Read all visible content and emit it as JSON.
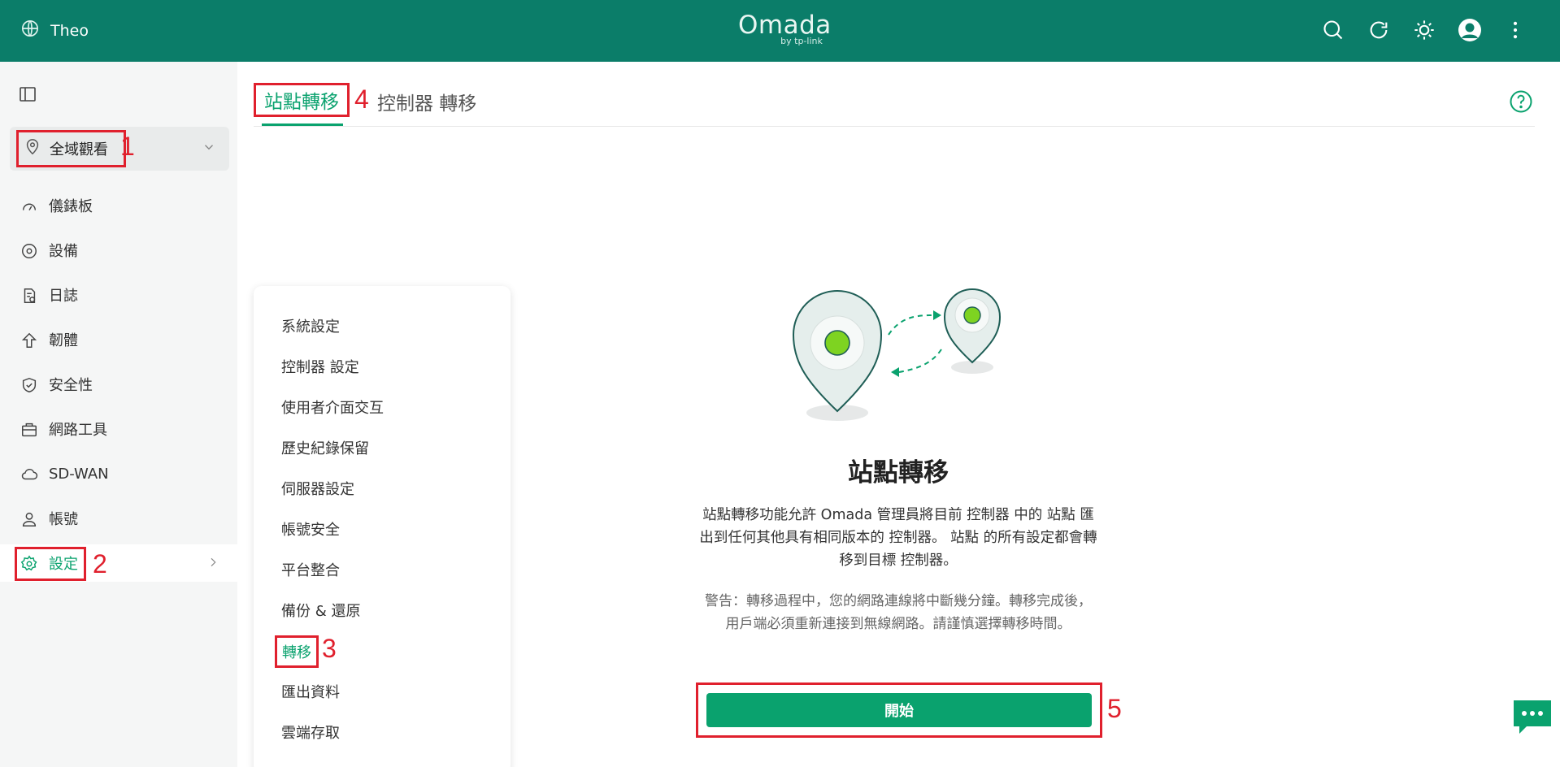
{
  "topbar": {
    "site_name": "Theo",
    "logo_text": "Omada",
    "logo_sub": "by tp-link",
    "actions": [
      "search-icon",
      "refresh-icon",
      "theme-icon",
      "avatar",
      "more-icon"
    ],
    "color": "#0b7d69"
  },
  "sidebar": {
    "scope_label": "全域觀看",
    "items": [
      {
        "label": "儀錶板",
        "icon": "dashboard-icon"
      },
      {
        "label": "設備",
        "icon": "devices-icon"
      },
      {
        "label": "日誌",
        "icon": "logs-icon"
      },
      {
        "label": "韌體",
        "icon": "firmware-icon"
      },
      {
        "label": "安全性",
        "icon": "shield-icon"
      },
      {
        "label": "網路工具",
        "icon": "toolbox-icon"
      },
      {
        "label": "SD-WAN",
        "icon": "cloud-icon"
      },
      {
        "label": "帳號",
        "icon": "user-icon"
      },
      {
        "label": "設定",
        "icon": "gear-icon",
        "active": true
      }
    ]
  },
  "submenu": {
    "items": [
      "系統設定",
      "控制器 設定",
      "使用者介面交互",
      "歷史紀錄保留",
      "伺服器設定",
      "帳號安全",
      "平台整合",
      "備份 & 還原",
      "轉移",
      "匯出資料",
      "雲端存取"
    ],
    "active_index": 8
  },
  "tabs": {
    "active": "站點轉移",
    "other": "控制器 轉移"
  },
  "content": {
    "title": "站點轉移",
    "description": "站點轉移功能允許 Omada 管理員將目前 控制器 中的 站點 匯出到任何其他具有相同版本的 控制器。 站點 的所有設定都會轉移到目標 控制器。",
    "warning": "警告：轉移過程中，您的網路連線將中斷幾分鐘。轉移完成後，用戶端必須重新連接到無線網路。請謹慎選擇轉移時間。",
    "start_button": "開始"
  },
  "annotations": {
    "mark1": "1",
    "mark2": "2",
    "mark3": "3",
    "mark4": "4",
    "mark5": "5",
    "color": "#e0202d"
  },
  "accent_color": "#0aa26e"
}
